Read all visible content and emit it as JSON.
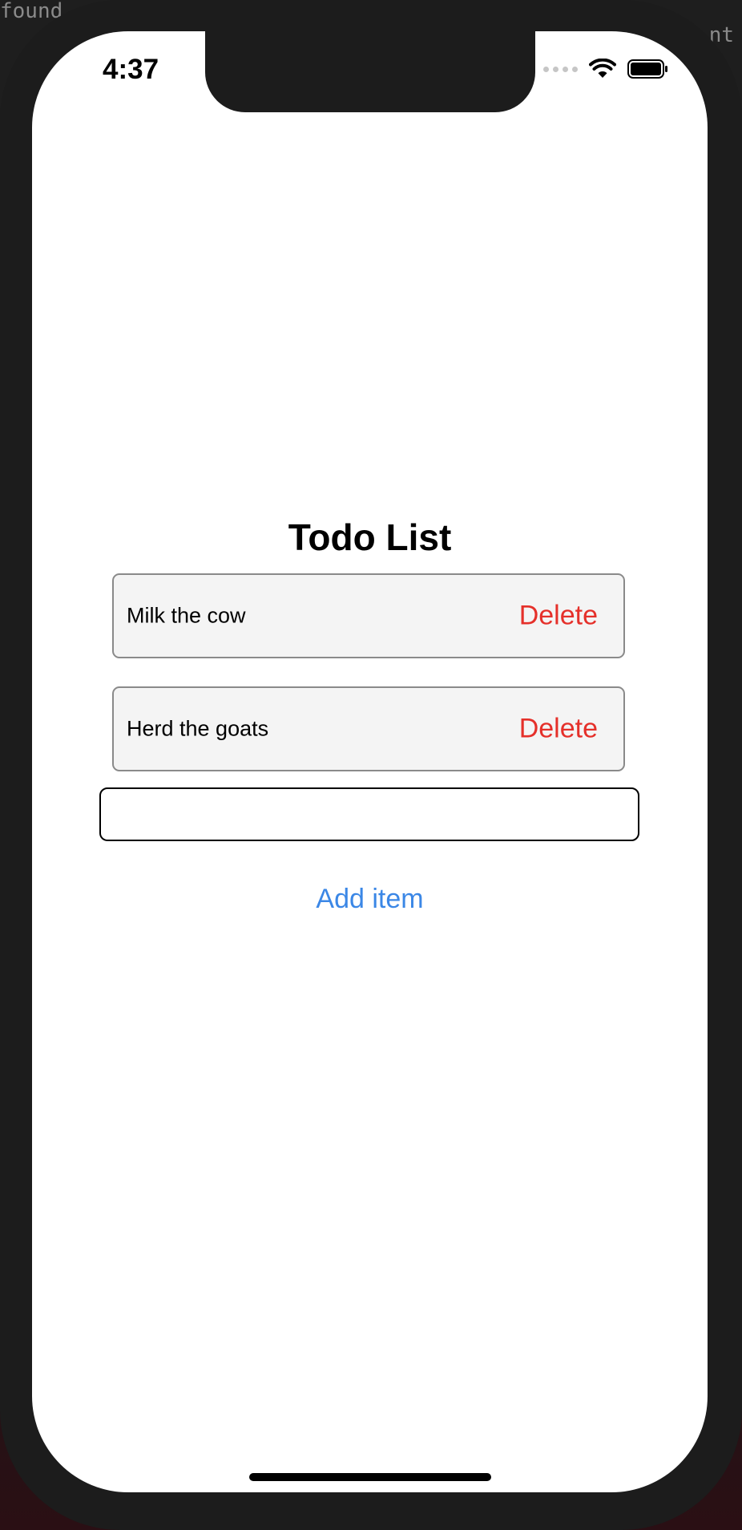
{
  "background_terminal": {
    "left_text": "found",
    "right_text": "nt"
  },
  "status_bar": {
    "time": "4:37"
  },
  "app": {
    "title": "Todo List",
    "items": [
      {
        "text": "Milk the cow",
        "delete_label": "Delete"
      },
      {
        "text": "Herd the goats",
        "delete_label": "Delete"
      }
    ],
    "new_item_input": {
      "value": "",
      "placeholder": ""
    },
    "add_button_label": "Add item"
  },
  "colors": {
    "delete": "#e5302a",
    "link": "#3b87e6",
    "item_background": "#f4f4f4"
  }
}
